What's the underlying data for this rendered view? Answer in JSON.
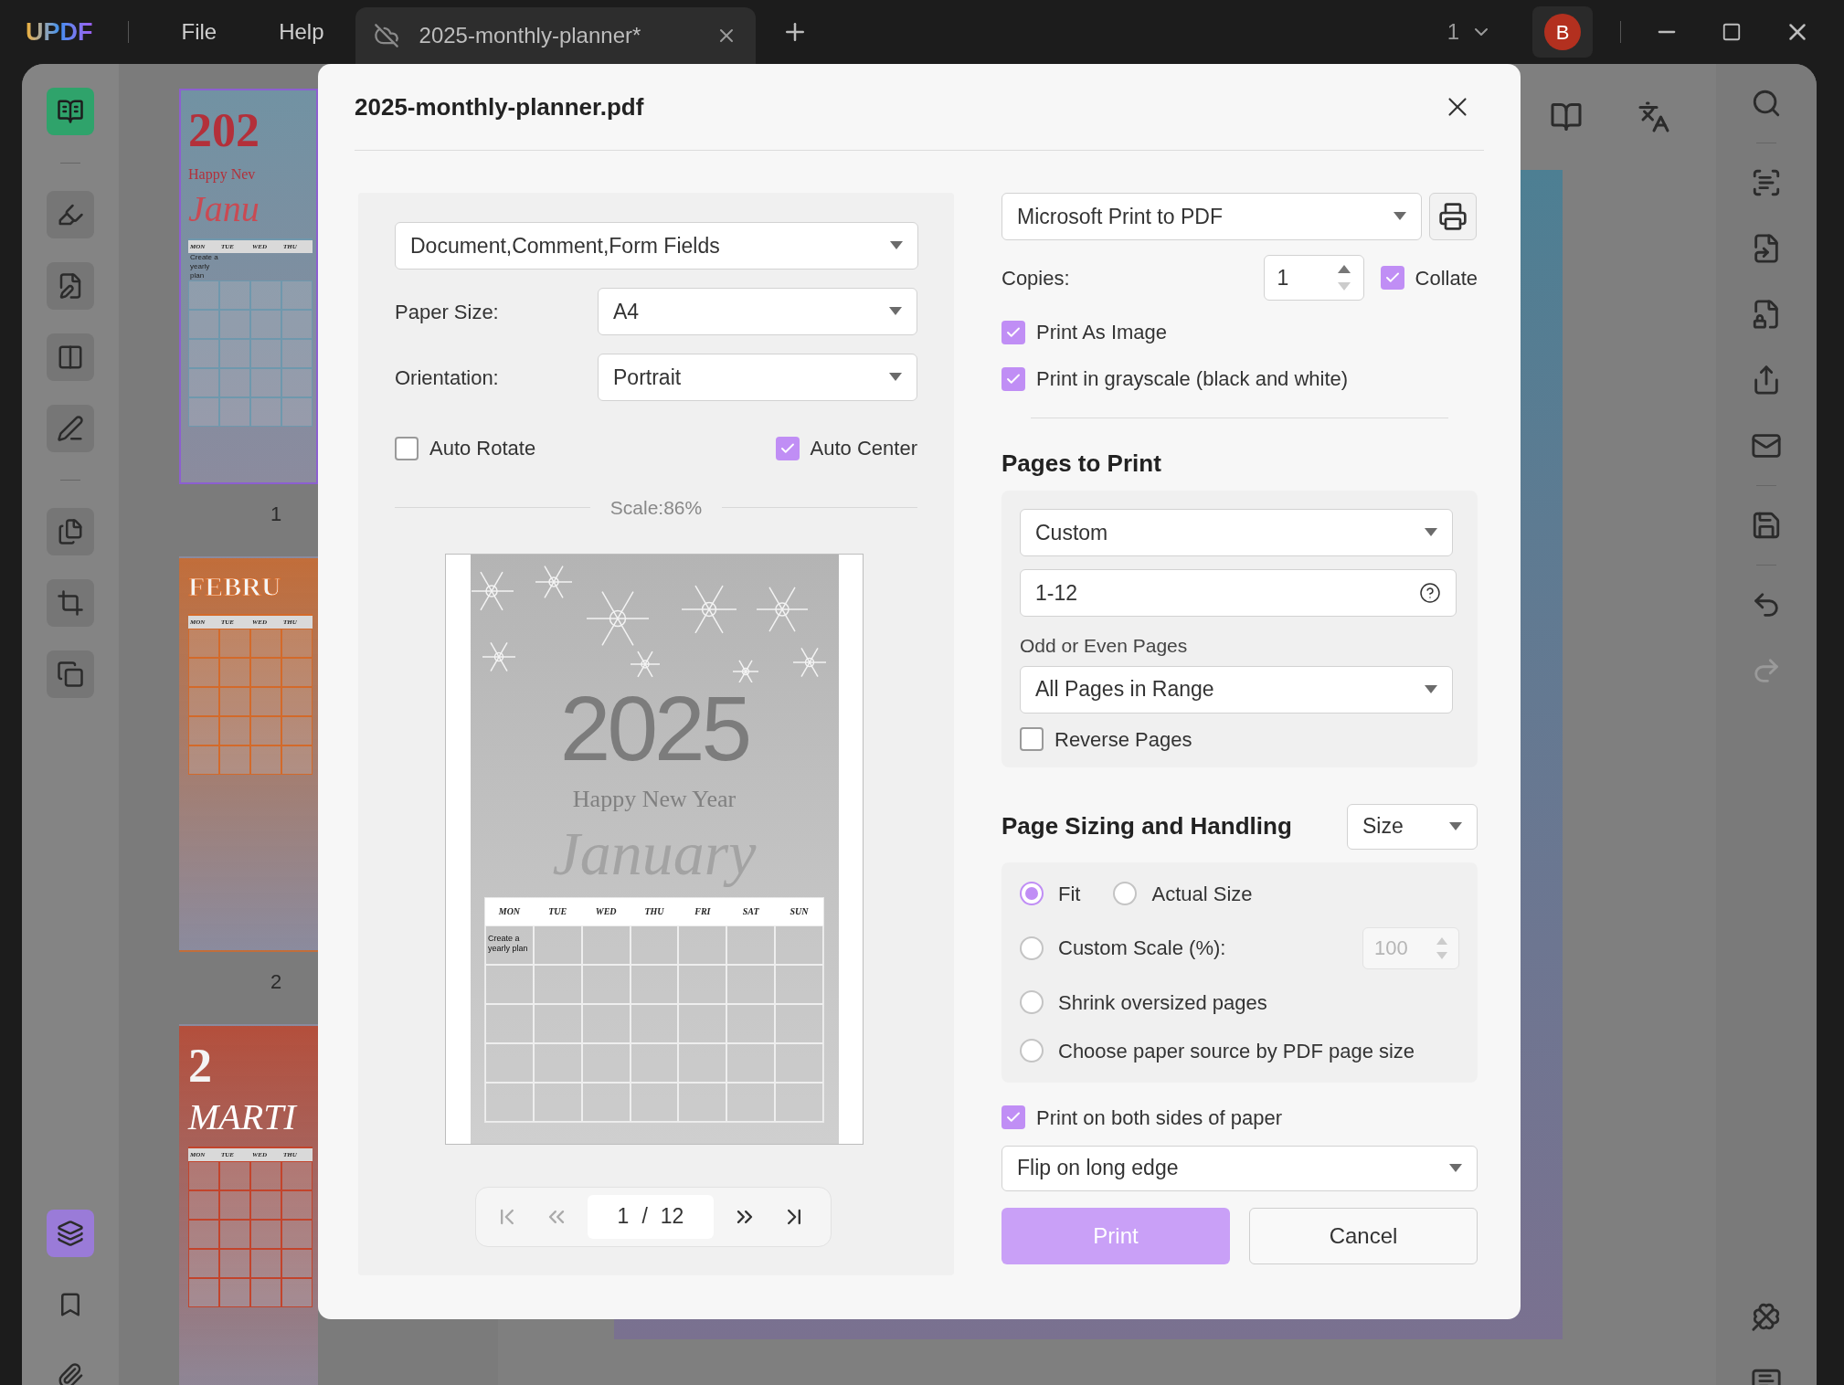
{
  "app": {
    "logo": "UPDF",
    "menu": [
      {
        "label": "File"
      },
      {
        "label": "Help"
      }
    ],
    "tab": {
      "title": "2025-monthly-planner*",
      "selected": true
    },
    "page_indicator": "1",
    "avatar": "B"
  },
  "left_toolbar": [
    {
      "items": [
        {
          "kind": "reader",
          "selected": true,
          "color": "#2fa36b"
        }
      ]
    },
    {
      "items": [
        {
          "kind": "highlight",
          "selected": false
        },
        {
          "kind": "edit",
          "selected": false
        },
        {
          "kind": "form",
          "selected": false
        },
        {
          "kind": "sign",
          "selected": false
        }
      ]
    },
    {
      "items": [
        {
          "kind": "pages",
          "selected": false
        },
        {
          "kind": "crop",
          "selected": false
        },
        {
          "kind": "copy",
          "selected": false
        }
      ]
    },
    {
      "items": [
        {
          "kind": "layers",
          "selected": true,
          "color": "#9a7bd8"
        },
        {
          "kind": "bookmark",
          "selected": false
        },
        {
          "kind": "attach",
          "selected": false
        }
      ]
    }
  ],
  "thumbnails": [
    {
      "selected": true,
      "color": "#6f98ad",
      "heading": "202",
      "subtitle": "Happy Nev",
      "month": "Janu",
      "days": [
        "MON",
        "TUE",
        "WED",
        "THU"
      ],
      "note": "Create a yearly plan",
      "label": "1"
    },
    {
      "selected": false,
      "color": "#d36a2a",
      "heading": "FEBRU",
      "days": [
        "MON",
        "TUE",
        "WED",
        "THU"
      ],
      "label": "2"
    },
    {
      "selected": false,
      "color": "#c2442c",
      "heading": "2",
      "month": "MARTI",
      "days": [
        "MON",
        "TUE",
        "WED",
        "THU"
      ]
    }
  ],
  "top_tools": [
    {
      "kind": "reader"
    },
    {
      "kind": "translate"
    }
  ],
  "right_toolbar": [
    {
      "items": [
        {
          "kind": "search",
          "disabled": false
        }
      ]
    },
    {
      "items": [
        {
          "kind": "ocr",
          "disabled": false
        },
        {
          "kind": "convert",
          "disabled": false
        },
        {
          "kind": "protect",
          "disabled": false
        },
        {
          "kind": "share",
          "disabled": false
        },
        {
          "kind": "mail",
          "disabled": false
        }
      ]
    },
    {
      "items": [
        {
          "kind": "save",
          "disabled": false
        }
      ]
    },
    {
      "items": [
        {
          "kind": "undo",
          "disabled": false
        },
        {
          "kind": "redo",
          "disabled": true
        }
      ]
    },
    {
      "items": [
        {
          "kind": "ai",
          "disabled": false
        },
        {
          "kind": "comment",
          "disabled": false
        }
      ]
    }
  ],
  "dialog": {
    "title": "2025-monthly-planner.pdf",
    "content_select": "Document,Comment,Form Fields",
    "paper_size": {
      "label": "Paper Size:",
      "value": "A4"
    },
    "orientation": {
      "label": "Orientation:",
      "value": "Portrait"
    },
    "auto_rotate": {
      "label": "Auto Rotate",
      "checked": false
    },
    "auto_center": {
      "label": "Auto Center",
      "checked": true
    },
    "scale": "Scale:86%",
    "preview": {
      "year": "2025",
      "greeting": "Happy New Year",
      "month": "January",
      "days": [
        "MON",
        "TUE",
        "WED",
        "THU",
        "FRI",
        "SAT",
        "SUN"
      ],
      "note": "Create a yearly plan"
    },
    "pager": {
      "current": "1",
      "separator": "/",
      "total": "12"
    },
    "printer": "Microsoft Print to PDF",
    "copies": {
      "label": "Copies:",
      "value": "1"
    },
    "collate": {
      "label": "Collate",
      "checked": true
    },
    "options": [
      {
        "label": "Print As Image",
        "checked": true
      },
      {
        "label": "Print in grayscale (black and white)",
        "checked": true
      }
    ],
    "pages_to_print": {
      "heading": "Pages to Print",
      "range_select": "Custom",
      "range_value": "1-12",
      "odd_even_label": "Odd or Even Pages",
      "odd_even_value": "All Pages in Range",
      "reverse": {
        "label": "Reverse Pages",
        "checked": false
      }
    },
    "sizing": {
      "heading": "Page Sizing and Handling",
      "mode_select": "Size",
      "options": [
        {
          "label": "Fit",
          "selected": true
        },
        {
          "label": "Actual Size",
          "selected": false
        },
        {
          "label": "Custom Scale (%):",
          "selected": false,
          "field": {
            "value": "100",
            "disabled": true
          }
        },
        {
          "label": "Shrink oversized pages",
          "selected": false
        },
        {
          "label": "Choose paper source by PDF page size",
          "selected": false
        }
      ]
    },
    "both_sides": {
      "label": "Print on both sides of paper",
      "checked": true
    },
    "flip_select": "Flip on long edge",
    "buttons": [
      {
        "label": "Print",
        "kind": "primary"
      },
      {
        "label": "Cancel",
        "kind": "secondary"
      }
    ]
  }
}
